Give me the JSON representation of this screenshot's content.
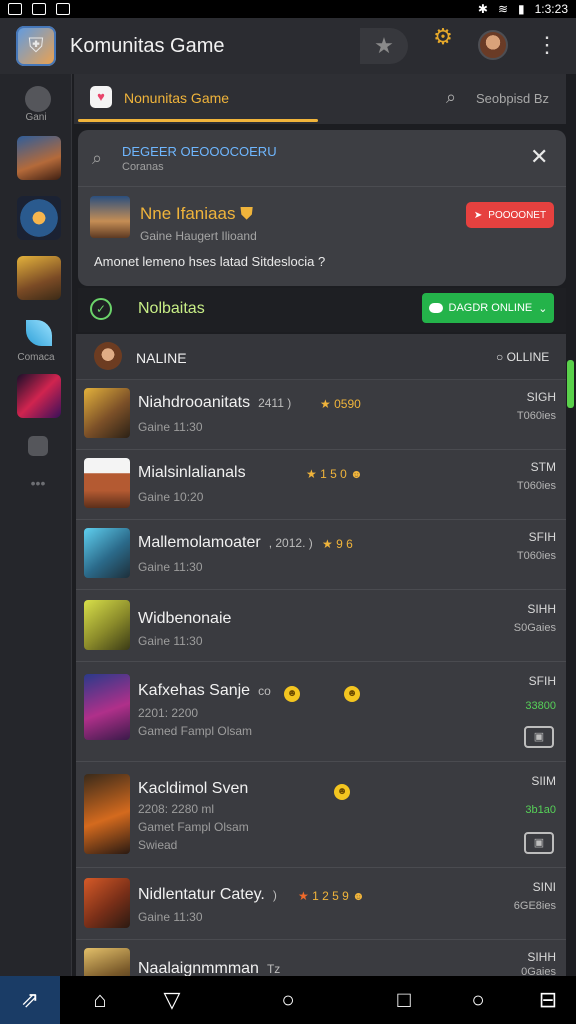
{
  "status_bar": {
    "left_icons": [
      "mail-icon",
      "photo-icon",
      "image-icon"
    ],
    "time": "1:3:23"
  },
  "app_bar": {
    "title": "Komunitas Game",
    "logo_icon": "shield-logo-icon",
    "star_icon": "star-icon",
    "bell_icon": "bell-icon",
    "menu_icon": "kebab-icon"
  },
  "sidebar": {
    "items": [
      {
        "label": "Gani",
        "icon": "compass-icon"
      },
      {
        "label": "",
        "icon": "game-thumb-1"
      },
      {
        "label": "",
        "icon": "game-thumb-2"
      },
      {
        "label": "",
        "icon": "game-thumb-3"
      },
      {
        "label": "Comaca",
        "icon": "feather-icon"
      },
      {
        "label": "",
        "icon": "game-thumb-4"
      },
      {
        "label": "",
        "icon": "chat-icon"
      },
      {
        "label": "",
        "icon": "more-icon"
      }
    ]
  },
  "tab_bar": {
    "tab_label": "Nonunitas Game",
    "search_text": "Seobpisd Bz"
  },
  "panel": {
    "search_title": "DEGEER OEOOOCOERU",
    "search_sub": "Coranas",
    "hero_title": "Nne Ifaniaas",
    "hero_sub": "Gaine Haugert Ilioand",
    "hero_button": "POOOONET",
    "description": "Amonet lemeno hses latad Sitdeslocia ?"
  },
  "section": {
    "title": "Nolbaitas",
    "button_label": "DAGDR ONLINE"
  },
  "list": {
    "header_title": "NALINE",
    "header_status": "OLLINE",
    "rows": [
      {
        "name": "Niahdrooanitats",
        "extra": "2411 )",
        "rating": "0590",
        "sub": "Gaine 11:30",
        "sub2": "",
        "time": "SIGH",
        "meta": "T060ies"
      },
      {
        "name": "Mialsinlalianals",
        "extra": "",
        "rating": "1 5 0",
        "sub": "Gaine 10:20",
        "sub2": "",
        "time": "STM",
        "meta": "T060ies"
      },
      {
        "name": "Mallemolamoater",
        "extra": ", 2012. )",
        "rating": "9 6",
        "sub": "Gaine 11:30",
        "sub2": "",
        "time": "SFIH",
        "meta": "T060ies"
      },
      {
        "name": "Widbenonaie",
        "extra": "",
        "rating": "",
        "sub": "Gaine 11:30",
        "sub2": "",
        "time": "SIHH",
        "meta": "S0Gaies"
      },
      {
        "name": "Kafxehas Sanje",
        "extra": "co",
        "rating": "",
        "sub": "2201: 2200",
        "sub2": "Gamed Fampl Olsam",
        "time": "SFIH",
        "meta": "33800"
      },
      {
        "name": "Kacldimol Sven",
        "extra": "",
        "rating": "",
        "sub": "2208: 2280 ml",
        "sub2": "Gamet Fampl Olsam",
        "sub3": "Swiead",
        "time": "SIIM",
        "meta": "3b1a0"
      },
      {
        "name": "Nidlentatur Catey.",
        "extra": ")",
        "rating": "1 2 5 9",
        "sub": "Gaine 11:30",
        "sub2": "",
        "time": "SINI",
        "meta": "6GE8ies"
      },
      {
        "name": "Naalaignmmman",
        "extra": "Tz",
        "rating": "",
        "sub": "",
        "sub2": "",
        "time": "SIHH",
        "meta": "0Gaies"
      }
    ]
  },
  "colors": {
    "accent": "#f0b43b",
    "live_green": "#24b34a",
    "danger": "#e6413f",
    "link_blue": "#6fb7ff"
  },
  "nav_bar": {
    "items": [
      "share-icon",
      "home-icon",
      "back-icon",
      "circle-icon",
      "square-icon",
      "circle-icon",
      "recent-icon"
    ]
  }
}
